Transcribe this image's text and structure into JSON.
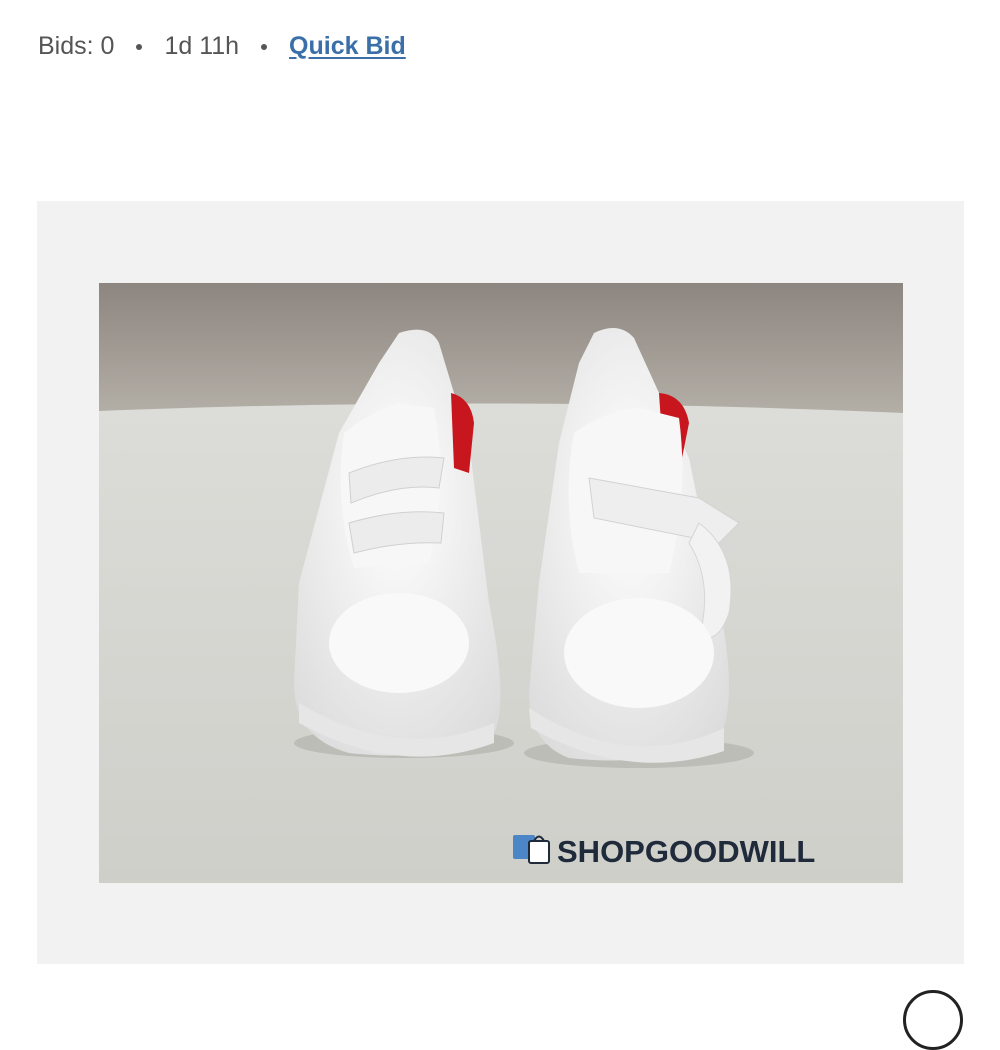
{
  "listing": {
    "bids_text": "Bids: 0",
    "time_left": "1d 11h",
    "quick_bid_label": "Quick Bid"
  },
  "image": {
    "watermark_text": "SHOPGOODWILL"
  },
  "colors": {
    "link": "#3a6fa8",
    "panel": "#f2f2f2",
    "shoe_accent": "#c8161e"
  },
  "icons": {
    "watermark": "shopping-bag-icon",
    "bottom": "circle-button-icon"
  }
}
